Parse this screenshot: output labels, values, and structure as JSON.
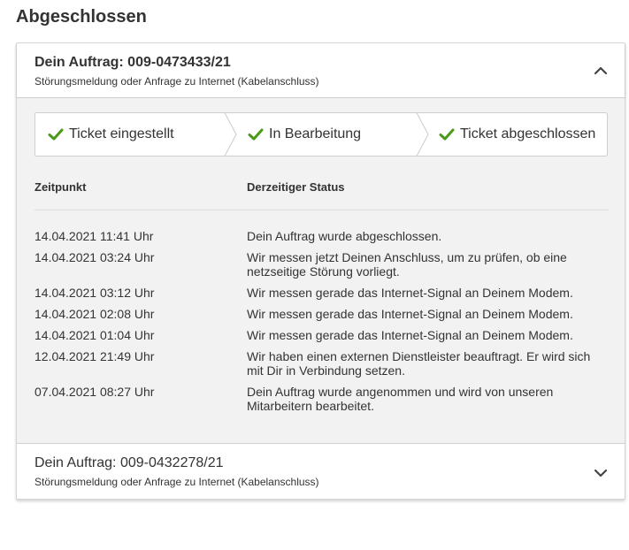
{
  "section_title": "Abgeschlossen",
  "orders": [
    {
      "title": "Dein Auftrag: 009-0473433/21",
      "subtitle": "Störungsmeldung oder Anfrage zu Internet (Kabelanschluss)",
      "expanded": true,
      "chevron_icon": "chevron-up-icon"
    },
    {
      "title": "Dein Auftrag: 009-0432278/21",
      "subtitle": "Störungsmeldung oder Anfrage zu Internet (Kabelanschluss)",
      "expanded": false,
      "chevron_icon": "chevron-down-icon"
    }
  ],
  "steps": [
    {
      "label": "Ticket eingestellt",
      "icon": "checkmark-icon",
      "done": true
    },
    {
      "label": "In Bearbeitung",
      "icon": "checkmark-icon",
      "done": true
    },
    {
      "label": "Ticket abgeschlossen",
      "icon": "checkmark-icon",
      "done": true
    }
  ],
  "table": {
    "headers": {
      "time": "Zeitpunkt",
      "status": "Derzeitiger Status"
    },
    "rows": [
      {
        "time": "14.04.2021 11:41 Uhr",
        "status": "Dein Auftrag wurde abgeschlossen."
      },
      {
        "time": "14.04.2021 03:24 Uhr",
        "status": "Wir messen jetzt Deinen Anschluss, um zu prüfen, ob eine netzseitige Störung vorliegt."
      },
      {
        "time": "14.04.2021 03:12 Uhr",
        "status": "Wir messen gerade das Internet-Signal an Deinem Modem."
      },
      {
        "time": "14.04.2021 02:08 Uhr",
        "status": "Wir messen gerade das Internet-Signal an Deinem Modem."
      },
      {
        "time": "14.04.2021 01:04 Uhr",
        "status": "Wir messen gerade das Internet-Signal an Deinem Modem."
      },
      {
        "time": "12.04.2021 21:49 Uhr",
        "status": "Wir haben einen externen Dienstleister beauftragt. Er wird sich mit Dir in Verbindung setzen."
      },
      {
        "time": "07.04.2021 08:27 Uhr",
        "status": "Dein Auftrag wurde angenommen und wird von unseren Mitarbeitern bearbeitet."
      }
    ]
  },
  "colors": {
    "check": "#4a9a1a",
    "panel_bg": "#f2f2f2",
    "text": "#333333"
  }
}
